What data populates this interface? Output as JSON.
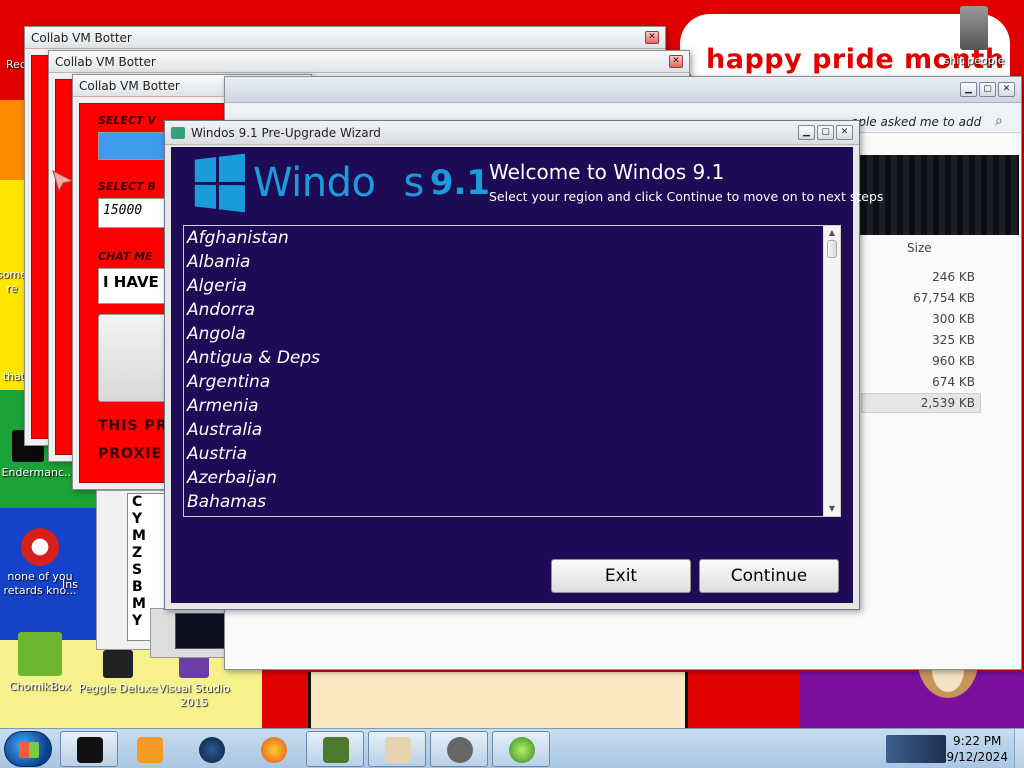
{
  "desktop": {
    "pride_text": "happy pride month",
    "icons": [
      {
        "label": "Rec"
      },
      {
        "label": "some\nre"
      },
      {
        "label": "that"
      },
      {
        "label": "Endermanc..."
      },
      {
        "label": "none of you\nretards kno..."
      },
      {
        "label": "Ins"
      },
      {
        "label": "ChomikBox"
      },
      {
        "label": "Peggle Deluxe"
      },
      {
        "label": "Visual Studio\n2015"
      },
      {
        "label": "shit people"
      }
    ]
  },
  "botter_windows": [
    {
      "title": "Collab VM Botter"
    },
    {
      "title": "Collab VM Botter"
    },
    {
      "title": "Collab VM Botter"
    }
  ],
  "botter": {
    "select_vm_label": "SELECT V",
    "select_b_label": "SELECT B",
    "amount_value": "15000",
    "chat_label": "CHAT ME",
    "chat_value": "I HAVE",
    "footer_line1": "THIS PR",
    "footer_line2": "PROXIE",
    "side_letters": [
      "C",
      "Y",
      "M",
      "Z",
      "S",
      "B",
      "M",
      "Y"
    ]
  },
  "explorer": {
    "search_hint": "ople asked me to add",
    "size_header": "Size",
    "sizes": [
      "246 KB",
      "67,754 KB",
      "300 KB",
      "325 KB",
      "960 KB",
      "674 KB",
      "2,539 KB"
    ]
  },
  "wizard": {
    "window_title": "Windos 9.1 Pre-Upgrade Wizard",
    "logo_name": "Windo",
    "logo_s": "s",
    "logo_version": "9.1",
    "heading": "Welcome to Windos 9.1",
    "subheading": "Select your region and click Continue to move on to next steps",
    "countries": [
      "Afghanistan",
      "Albania",
      "Algeria",
      "Andorra",
      "Angola",
      "Antigua & Deps",
      "Argentina",
      "Armenia",
      "Australia",
      "Austria",
      "Azerbaijan",
      "Bahamas"
    ],
    "exit_label": "Exit",
    "continue_label": "Continue"
  },
  "taskbar": {
    "time": "9:22 PM",
    "date": "9/12/2024"
  },
  "colors": {
    "wizard_bg": "#1e0b56",
    "brand_blue": "#1a9bdc",
    "botter_red": "#ff0000"
  }
}
